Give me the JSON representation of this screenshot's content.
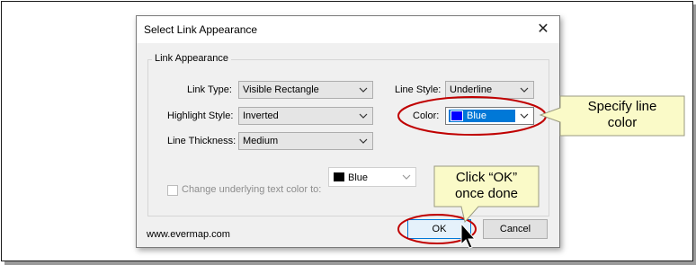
{
  "dialog": {
    "title": "Select Link Appearance",
    "close_glyph": "✕",
    "group_label": "Link Appearance",
    "fields": {
      "link_type": {
        "label": "Link Type:",
        "value": "Visible Rectangle"
      },
      "highlight_style": {
        "label": "Highlight Style:",
        "value": "Inverted"
      },
      "line_thickness": {
        "label": "Line Thickness:",
        "value": "Medium"
      },
      "line_style": {
        "label": "Line Style:",
        "value": "Underline"
      },
      "color": {
        "label": "Color:",
        "value": "Blue",
        "swatch_color": "#0000ff",
        "highlight_color": "#0078d7"
      }
    },
    "change_text_color": {
      "label": "Change underlying text color to:",
      "checked": false,
      "value": "Blue",
      "swatch_color": "#000000"
    },
    "url": "www.evermap.com",
    "buttons": {
      "ok": "OK",
      "cancel": "Cancel"
    }
  },
  "callouts": {
    "color_callout": {
      "line1": "Specify line",
      "line2": "color",
      "fill": "#fafac8"
    },
    "ok_callout": {
      "line1": "Click “OK”",
      "line2": "once done",
      "fill": "#fafac8"
    },
    "ellipse_color": "#c00000"
  }
}
